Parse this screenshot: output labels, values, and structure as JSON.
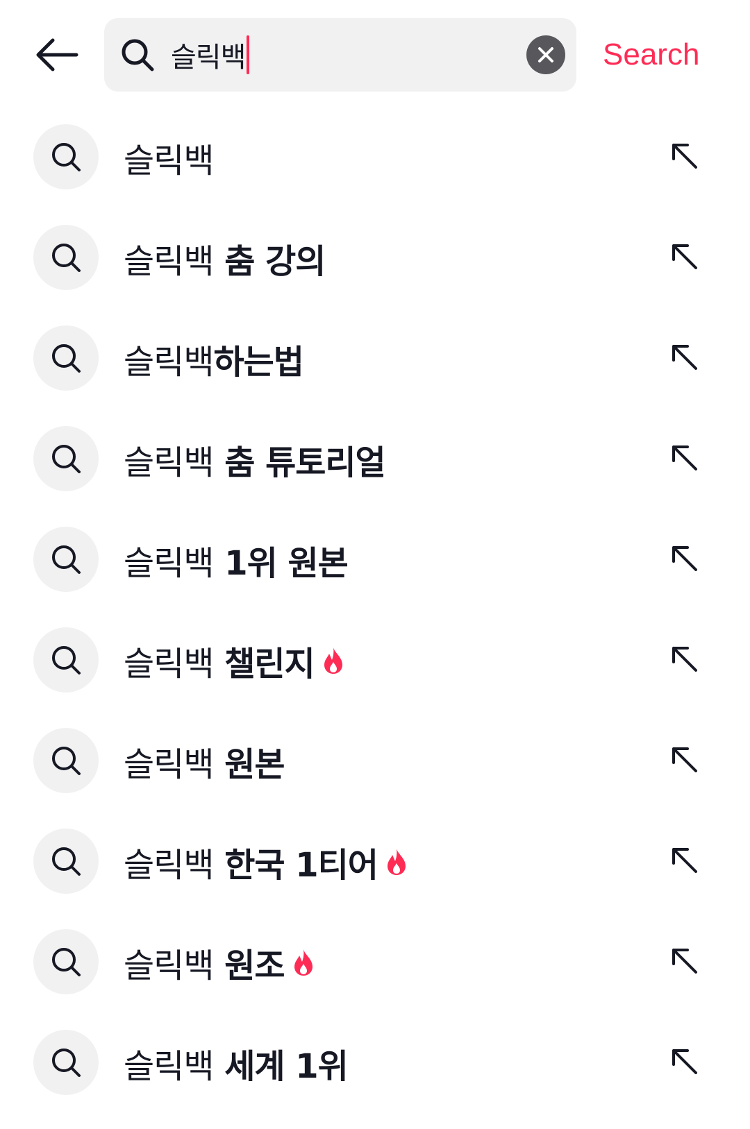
{
  "header": {
    "query": "슬릭백",
    "search_label": "Search",
    "back_icon": "arrow-left-icon",
    "clear_icon": "close-circle-icon"
  },
  "colors": {
    "accent": "#fe2c55",
    "text": "#161823",
    "chip_bg": "#f1f1f2",
    "clear_bg": "#57575c"
  },
  "suggestions": [
    {
      "base": "슬릭백",
      "suffix": "",
      "hot": false
    },
    {
      "base": "슬릭백",
      "suffix": " 춤 강의",
      "hot": false
    },
    {
      "base": "슬릭백",
      "suffix": "하는법",
      "hot": false
    },
    {
      "base": "슬릭백",
      "suffix": " 춤 튜토리얼",
      "hot": false
    },
    {
      "base": "슬릭백",
      "suffix": " 1위 원본",
      "hot": false
    },
    {
      "base": "슬릭백",
      "suffix": " 챌린지",
      "hot": true
    },
    {
      "base": "슬릭백",
      "suffix": " 원본",
      "hot": false
    },
    {
      "base": "슬릭백",
      "suffix": " 한국 1티어",
      "hot": true
    },
    {
      "base": "슬릭백",
      "suffix": " 원조",
      "hot": true
    },
    {
      "base": "슬릭백",
      "suffix": " 세계 1위",
      "hot": false
    }
  ]
}
